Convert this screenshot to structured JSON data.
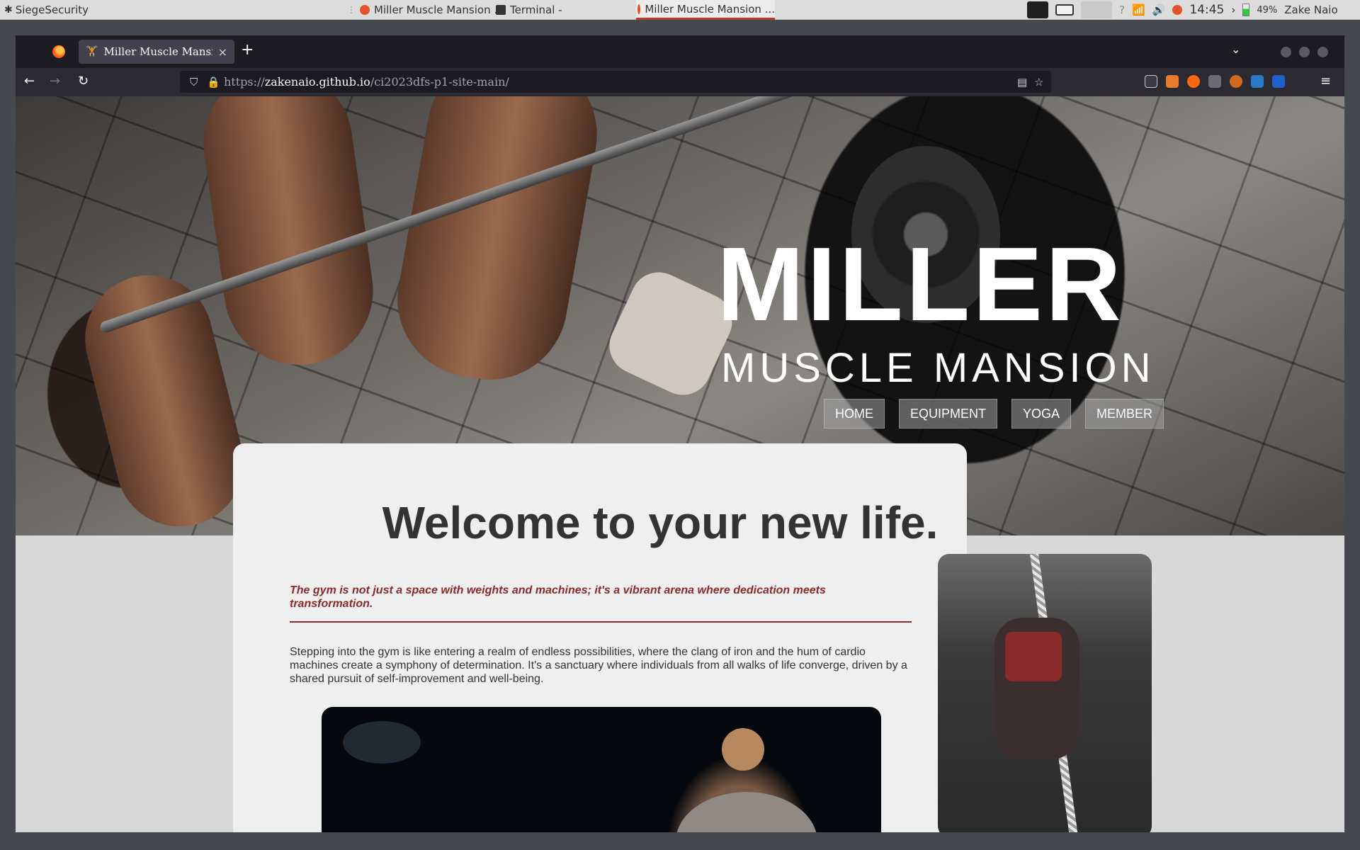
{
  "system_panel": {
    "app_menu": "SiegeSecurity",
    "tasks": [
      {
        "label": "Miller Muscle Mansion ..."
      },
      {
        "label": "Terminal -"
      },
      {
        "label": "Miller Muscle Mansion ..."
      }
    ],
    "clock": "14:45",
    "battery": "49%",
    "user": "Zake Naio"
  },
  "browser": {
    "tab": {
      "title": "Miller Muscle Mansion",
      "close": "×"
    },
    "new_tab": "+",
    "url": {
      "scheme": "https://",
      "host": "zakenaio.github.io",
      "path": "/ci2023dfs-p1-site-main/"
    }
  },
  "site": {
    "title": "MILLER",
    "subtitle": "MUSCLE MANSION",
    "nav": [
      "HOME",
      "EQUIPMENT",
      "YOGA",
      "MEMBER"
    ],
    "welcome_heading": "Welcome to your new life.",
    "quote": "The gym is not just a space with weights and machines; it's a vibrant arena where dedication meets transformation.",
    "paragraph": "Stepping into the gym is like entering a realm of endless possibilities, where the clang of iron and the hum of cardio machines create a symphony of determination. It's a sanctuary where individuals from all walks of life converge, driven by a shared pursuit of self-improvement and well-being."
  },
  "colors": {
    "accent": "#8a2a2a",
    "page_bg": "#d8d8d8",
    "card_bg": "#efefef"
  }
}
